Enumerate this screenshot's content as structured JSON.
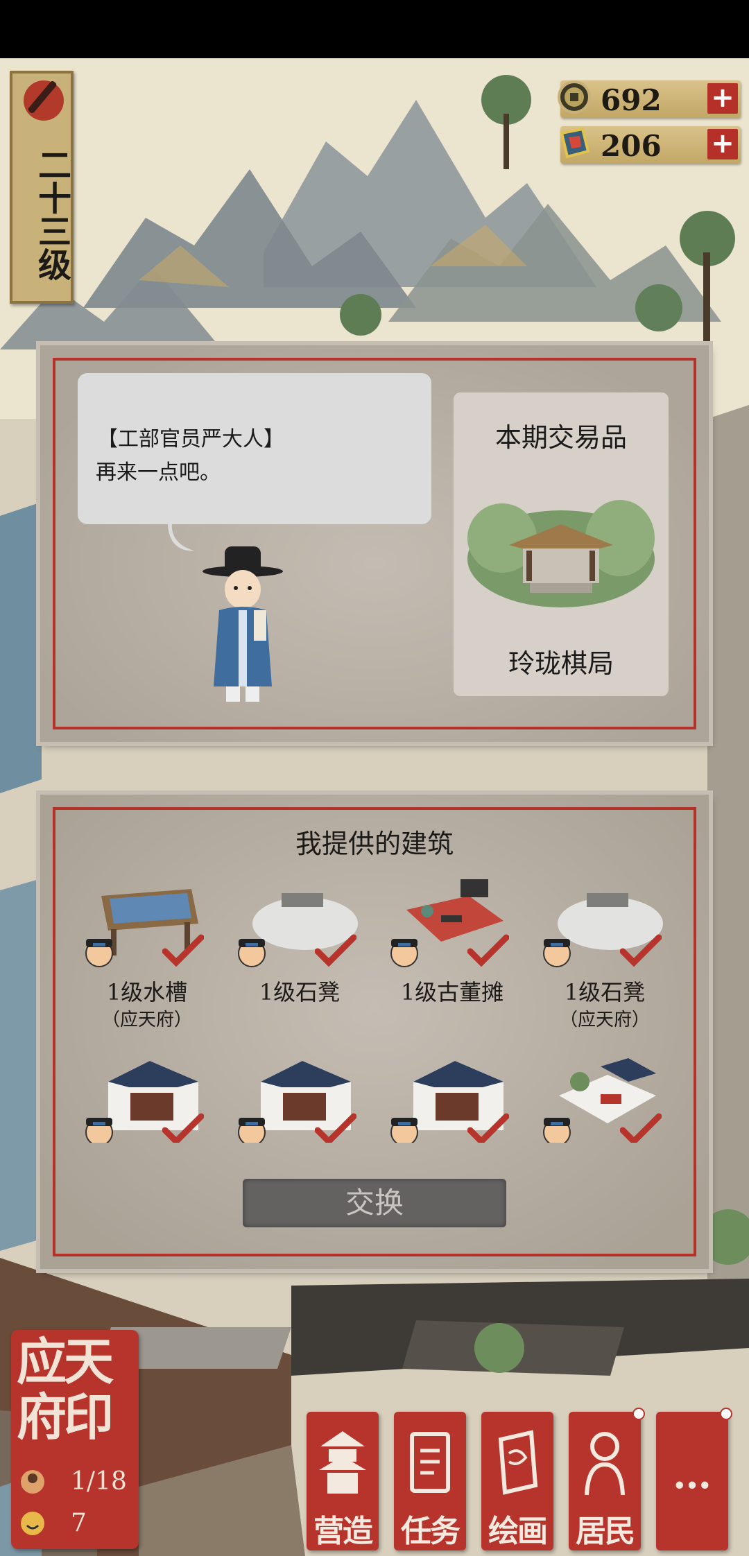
{
  "level": {
    "text": "二十三级"
  },
  "currency": [
    {
      "icon": "coin-icon",
      "value": "692"
    },
    {
      "icon": "jade-icon",
      "value": "206"
    }
  ],
  "dialog": {
    "speaker": "【工部官员严大人】",
    "message": "再来一点吧。"
  },
  "trade": {
    "title": "本期交易品",
    "item_name": "玲珑棋局"
  },
  "offer": {
    "title": "我提供的建筑",
    "items": [
      {
        "label": "1级水槽",
        "sub": "（应天府）",
        "checked": true
      },
      {
        "label": "1级石凳",
        "sub": "",
        "checked": true
      },
      {
        "label": "1级古董摊",
        "sub": "",
        "checked": true
      },
      {
        "label": "1级石凳",
        "sub": "（应天府）",
        "checked": true
      },
      {
        "label": "",
        "sub": "",
        "checked": true
      },
      {
        "label": "",
        "sub": "",
        "checked": true
      },
      {
        "label": "",
        "sub": "",
        "checked": true
      },
      {
        "label": "",
        "sub": "",
        "checked": true
      }
    ],
    "exchange_label": "交换"
  },
  "seal": {
    "title": "应天府印",
    "stat1": "1/18",
    "stat2": "7"
  },
  "nav": [
    {
      "label": "营造",
      "icon": "pagoda-icon"
    },
    {
      "label": "任务",
      "icon": "book-icon"
    },
    {
      "label": "绘画",
      "icon": "scroll-icon"
    },
    {
      "label": "居民",
      "icon": "resident-icon"
    },
    {
      "label": "…",
      "icon": "more-icon"
    }
  ],
  "colors": {
    "accent_red": "#b6342c",
    "panel_gray": "#b9b1a7",
    "gold": "#c9b27a"
  }
}
